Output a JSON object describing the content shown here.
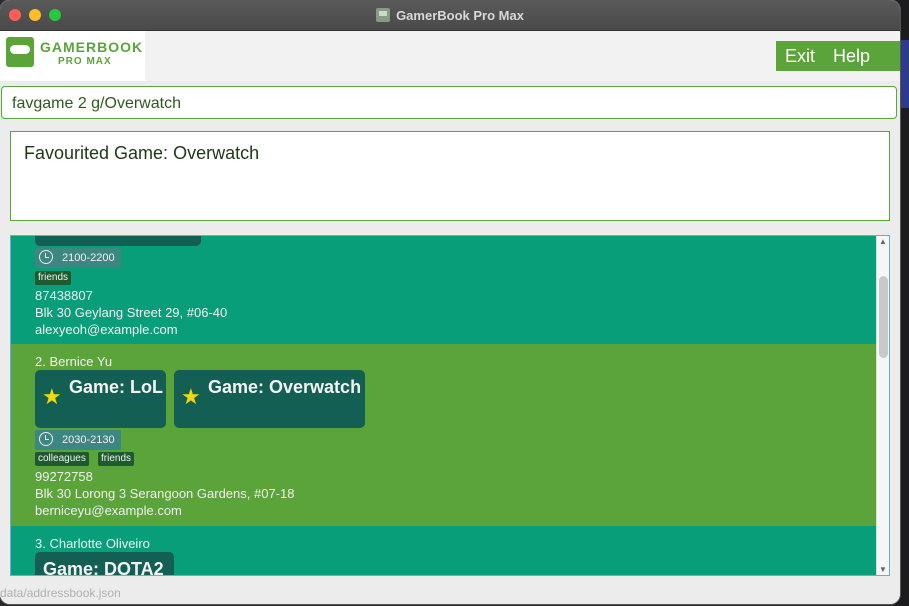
{
  "window": {
    "title": "GamerBook Pro Max"
  },
  "logo": {
    "title": "GAMERBOOK",
    "subtitle": "PRO MAX"
  },
  "menu": {
    "exit": "Exit",
    "help": "Help"
  },
  "command": {
    "value": "favgame 2 g/Overwatch"
  },
  "result": {
    "text": "Favourited Game: Overwatch"
  },
  "persons": [
    {
      "time": "2100-2200",
      "tags": [
        "friends"
      ],
      "phone": "87438807",
      "address": "Blk 30 Geylang Street 29, #06-40",
      "email": "alexyeoh@example.com"
    },
    {
      "name": "2. Bernice Yu",
      "games": [
        "Game: LoL",
        "Game: Overwatch"
      ],
      "time": "2030-2130",
      "tags": [
        "colleagues",
        "friends"
      ],
      "phone": "99272758",
      "address": "Blk 30 Lorong 3 Serangoon Gardens, #07-18",
      "email": "berniceyu@example.com"
    },
    {
      "name": "3. Charlotte Oliveiro",
      "games": [
        "Game: DOTA2"
      ]
    }
  ],
  "status": {
    "path": "data/addressbook.json"
  },
  "icons": {
    "favourite": "star-icon",
    "time": "clock-icon"
  },
  "colors": {
    "accent": "#5aa43a",
    "card_teal": "#089e79",
    "card_green": "#5aa43a",
    "game_tag": "#135f53",
    "star": "#f5d80b"
  }
}
